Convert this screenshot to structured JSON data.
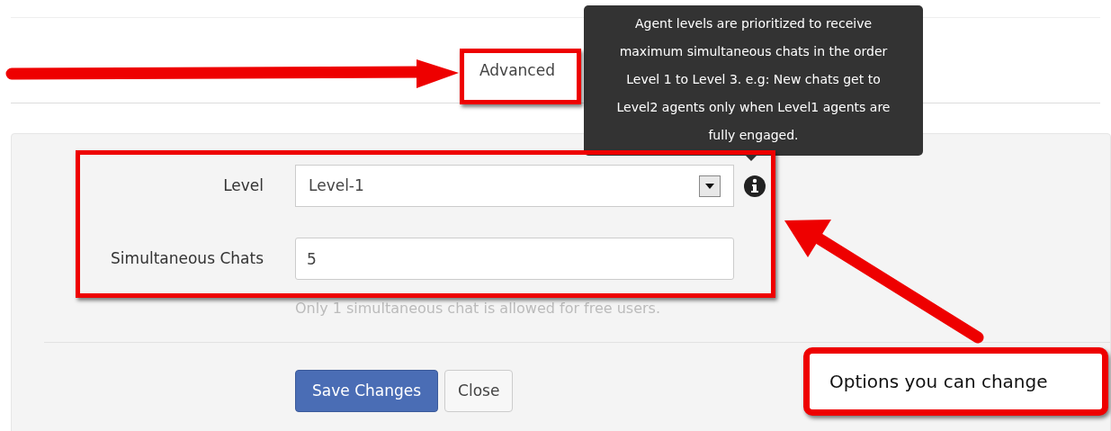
{
  "tabs": [
    {
      "label": "Advanced",
      "selected": true
    }
  ],
  "tooltip": {
    "text": "Agent levels are prioritized to receive maximum simultaneous chats in the order Level 1 to Level 3. e.g: New chats get to Level2 agents only when Level1 agents are fully engaged."
  },
  "form": {
    "level": {
      "label": "Level",
      "value": "Level-1"
    },
    "chats": {
      "label": "Simultaneous Chats",
      "value": "5",
      "hint": "Only 1 simultaneous chat is allowed for free users."
    }
  },
  "buttons": [
    {
      "label": "Save Changes",
      "kind": "primary"
    },
    {
      "label": "Close",
      "kind": "default"
    }
  ],
  "callout": {
    "text": "Options you can change"
  }
}
